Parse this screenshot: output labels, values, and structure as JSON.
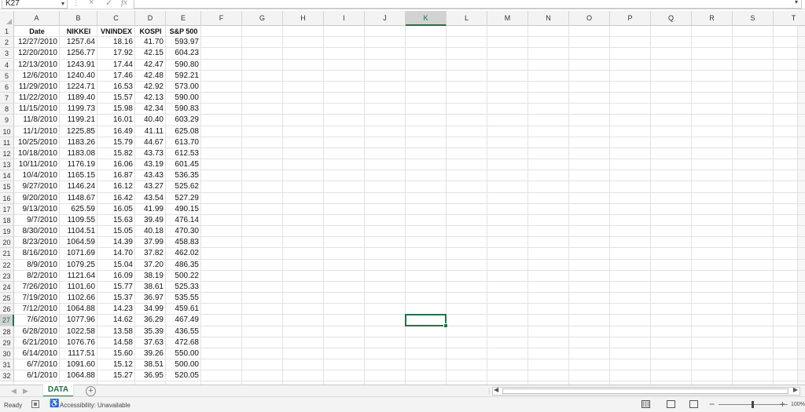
{
  "formula_bar": {
    "name_box": "K27",
    "dots": "⋮",
    "cancel_icon": "×",
    "enter_icon": "✓",
    "fx_label": "fx",
    "formula": ""
  },
  "columns": [
    "A",
    "B",
    "C",
    "D",
    "E",
    "F",
    "G",
    "H",
    "I",
    "J",
    "K",
    "L",
    "M",
    "N",
    "O",
    "P",
    "Q",
    "R",
    "S",
    "T"
  ],
  "selected_column": "K",
  "selected_row": 27,
  "headers": [
    "Date",
    "NIKKEI",
    "VNINDEX",
    "KOSPI",
    "S&P 500"
  ],
  "rows": [
    [
      "12/27/2010",
      "1257.64",
      "18.16",
      "41.70",
      "593.97"
    ],
    [
      "12/20/2010",
      "1256.77",
      "17.92",
      "42.15",
      "604.23"
    ],
    [
      "12/13/2010",
      "1243.91",
      "17.44",
      "42.47",
      "590.80"
    ],
    [
      "12/6/2010",
      "1240.40",
      "17.46",
      "42.48",
      "592.21"
    ],
    [
      "11/29/2010",
      "1224.71",
      "16.53",
      "42.92",
      "573.00"
    ],
    [
      "11/22/2010",
      "1189.40",
      "15.57",
      "42.13",
      "590.00"
    ],
    [
      "11/15/2010",
      "1199.73",
      "15.98",
      "42.34",
      "590.83"
    ],
    [
      "11/8/2010",
      "1199.21",
      "16.01",
      "40.40",
      "603.29"
    ],
    [
      "11/1/2010",
      "1225.85",
      "16.49",
      "41.11",
      "625.08"
    ],
    [
      "10/25/2010",
      "1183.26",
      "15.79",
      "44.67",
      "613.70"
    ],
    [
      "10/18/2010",
      "1183.08",
      "15.82",
      "43.73",
      "612.53"
    ],
    [
      "10/11/2010",
      "1176.19",
      "16.06",
      "43.19",
      "601.45"
    ],
    [
      "10/4/2010",
      "1165.15",
      "16.87",
      "43.43",
      "536.35"
    ],
    [
      "9/27/2010",
      "1146.24",
      "16.12",
      "43.27",
      "525.62"
    ],
    [
      "9/20/2010",
      "1148.67",
      "16.42",
      "43.54",
      "527.29"
    ],
    [
      "9/13/2010",
      "625.59",
      "16.05",
      "41.99",
      "490.15"
    ],
    [
      "9/7/2010",
      "1109.55",
      "15.63",
      "39.49",
      "476.14"
    ],
    [
      "8/30/2010",
      "1104.51",
      "15.05",
      "40.18",
      "470.30"
    ],
    [
      "8/23/2010",
      "1064.59",
      "14.39",
      "37.99",
      "458.83"
    ],
    [
      "8/16/2010",
      "1071.69",
      "14.70",
      "37.82",
      "462.02"
    ],
    [
      "8/9/2010",
      "1079.25",
      "15.04",
      "37.20",
      "486.35"
    ],
    [
      "8/2/2010",
      "1121.64",
      "16.09",
      "38.19",
      "500.22"
    ],
    [
      "7/26/2010",
      "1101.60",
      "15.77",
      "38.61",
      "525.33"
    ],
    [
      "7/19/2010",
      "1102.66",
      "15.37",
      "36.97",
      "535.55"
    ],
    [
      "7/12/2010",
      "1064.88",
      "14.23",
      "34.99",
      "459.61"
    ],
    [
      "7/6/2010",
      "1077.96",
      "14.62",
      "36.29",
      "467.49"
    ],
    [
      "6/28/2010",
      "1022.58",
      "13.58",
      "35.39",
      "436.55"
    ],
    [
      "6/21/2010",
      "1076.76",
      "14.58",
      "37.63",
      "472.68"
    ],
    [
      "6/14/2010",
      "1117.51",
      "15.60",
      "39.26",
      "550.00"
    ],
    [
      "6/7/2010",
      "1091.60",
      "15.12",
      "38.51",
      "500.00"
    ],
    [
      "6/1/2010",
      "1064.88",
      "15.27",
      "36.95",
      "520.05"
    ]
  ],
  "sheet_tabs": {
    "prev": "◀",
    "next": "▶",
    "active": "DATA",
    "add": "+",
    "separator": "⋮",
    "scroll_left": "◀",
    "scroll_right": "▶"
  },
  "status_bar": {
    "ready": "Ready",
    "accessibility": "Accessibility: Unavailable",
    "zoom_minus": "−",
    "zoom_plus": "+",
    "zoom": "100%"
  },
  "colors": {
    "accent": "#217346",
    "header_bg": "#f3f3f3",
    "gridline": "#e2e2e2"
  }
}
